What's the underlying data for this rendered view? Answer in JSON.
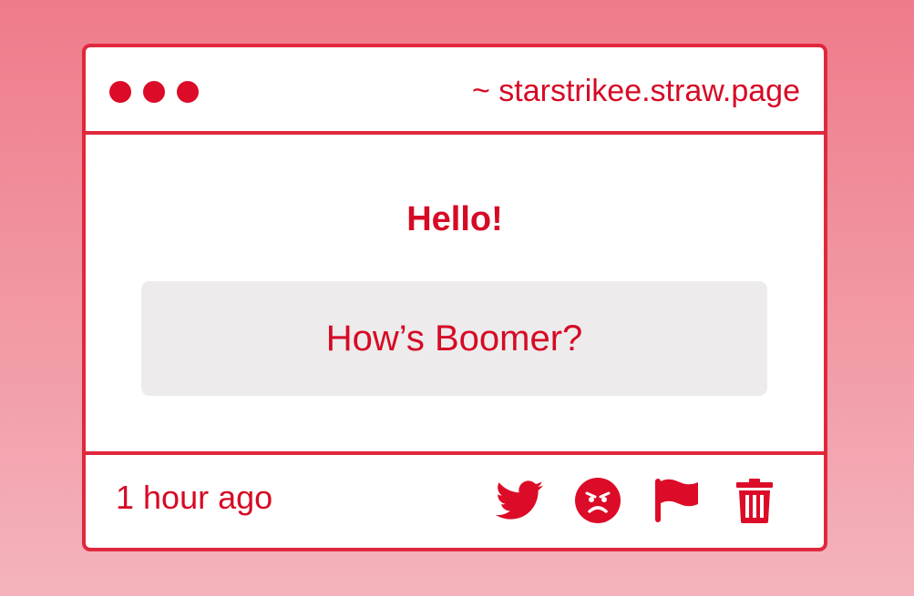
{
  "window": {
    "url": "~ starstrikee.straw.page"
  },
  "content": {
    "greeting": "Hello!",
    "message": "How’s Boomer?"
  },
  "footer": {
    "timestamp": "1 hour ago",
    "actions": [
      {
        "icon": "twitter-icon"
      },
      {
        "icon": "angry-face-icon"
      },
      {
        "icon": "flag-icon"
      },
      {
        "icon": "trash-icon"
      }
    ]
  },
  "colors": {
    "accent": "#dc0b27",
    "border": "#e0283c",
    "message_bg": "#edebec",
    "background_top": "#ef7b8a",
    "background_bottom": "#f4b3bc"
  }
}
